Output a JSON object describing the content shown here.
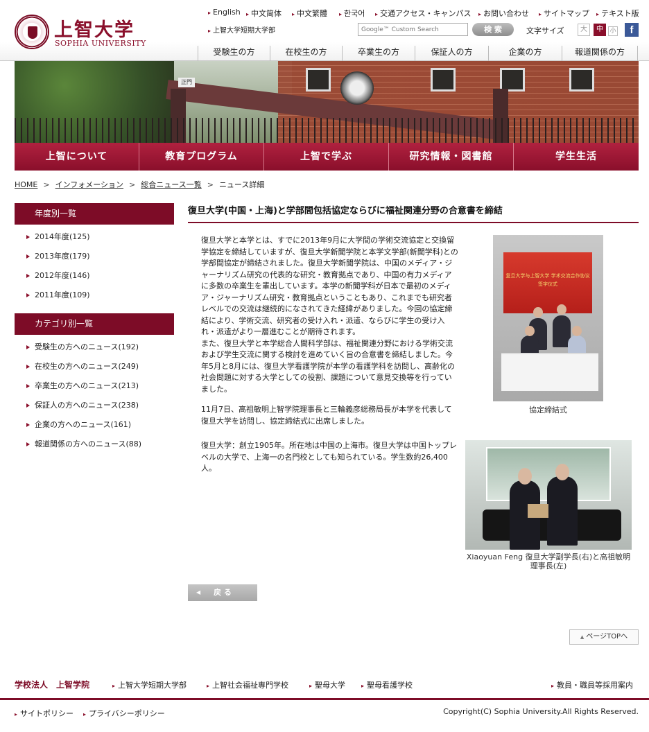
{
  "header": {
    "logo_jp": "上智大学",
    "logo_en": "SOPHIA UNIVERSITY",
    "top_links": [
      "English",
      "中文简体",
      "中文繁體",
      "한국어",
      "交通アクセス・キャンパス",
      "お問い合わせ",
      "サイトマップ",
      "テキスト版"
    ],
    "junior_college_link": "上智大学短期大学部",
    "search_placeholder": "Google™ Custom Search",
    "search_button": "検 索",
    "font_size_label": "文字サイズ",
    "font_sizes": [
      "大",
      "中",
      "小"
    ],
    "facebook_icon": "f",
    "audience_nav": [
      "受験生の方",
      "在校生の方",
      "卒業生の方",
      "保証人の方",
      "企業の方",
      "報道関係の方"
    ]
  },
  "hero": {
    "sign_text": "正門"
  },
  "main_nav": [
    "上智について",
    "教育プログラム",
    "上智で学ぶ",
    "研究情報・図書館",
    "学生生活"
  ],
  "breadcrumb": {
    "items": [
      "HOME",
      "インフォメーション",
      "総合ニュース一覧",
      "ニュース詳細"
    ],
    "separator": ">"
  },
  "sidebar": {
    "year_heading": "年度別一覧",
    "years": [
      "2014年度(125)",
      "2013年度(179)",
      "2012年度(146)",
      "2011年度(109)"
    ],
    "category_heading": "カテゴリ別一覧",
    "categories": [
      "受験生の方へのニュース(192)",
      "在校生の方へのニュース(249)",
      "卒業生の方へのニュース(213)",
      "保証人の方へのニュース(238)",
      "企業の方へのニュース(161)",
      "報道関係の方へのニュース(88)"
    ]
  },
  "article": {
    "title": "復旦大学(中国・上海)と学部間包括協定ならびに福祉関連分野の合意書を締結",
    "para1": "復旦大学と本学とは、すでに2013年9月に大学間の学術交流協定と交換留学協定を締結していますが、復旦大学新聞学院と本学文学部(新聞学科)との学部間協定が締結されました。復旦大学新聞学院は、中国のメディア・ジャーナリズム研究の代表的な研究・教育拠点であり、中国の有力メディアに多数の卒業生を輩出しています。本学の新聞学科が日本で最初のメディア・ジャーナリズム研究・教育拠点ということもあり、これまでも研究者レベルでの交流は継続的になされてきた経緯がありました。今回の協定締結により、学術交流、研究者の受け入れ・派遣、ならびに学生の受け入れ・派遣がより一層進むことが期待されます。",
    "para1b": "また、復旦大学と本学総合人間科学部は、福祉関連分野における学術交流および学生交流に関する検討を進めていく旨の合意書を締結しました。今年5月と8月には、復旦大学看護学院が本学の看護学科を訪問し、高齢化の社会問題に対する大学としての役割、課題について意見交換等を行っていました。",
    "para2": "11月7日、高祖敏明上智学院理事長と三輪義彦総務局長が本学を代表して復旦大学を訪問し、協定締結式に出席しました。",
    "para3": "復旦大学：創立1905年。所在地は中国の上海市。復旦大学は中国トップレベルの大学で、上海一の名門校としても知られている。学生数約26,400人。",
    "photo1_screen": "复旦大学与上智大学 学术交流合作协议 签字仪式",
    "caption1": "協定締結式",
    "caption2": "Xiaoyuan Feng 復旦大学副学長(右)と高祖敏明理事長(左)",
    "back_button": "戻 る",
    "page_top": "ページTOPへ"
  },
  "footer": {
    "corp_name": "学校法人　上智学院",
    "links": [
      "上智大学短期大学部",
      "上智社会福祉専門学校",
      "聖母大学",
      "聖母看護学校"
    ],
    "recruit_link": "教員・職員等採用案内",
    "bottom_links": [
      "サイトポリシー",
      "プライバシーポリシー"
    ],
    "copyright": "Copyright(C) Sophia University.All Rights Reserved."
  },
  "colors": {
    "brand": "#8a0f2b",
    "brand_dark": "#7d0c27",
    "facebook": "#3b5998"
  }
}
